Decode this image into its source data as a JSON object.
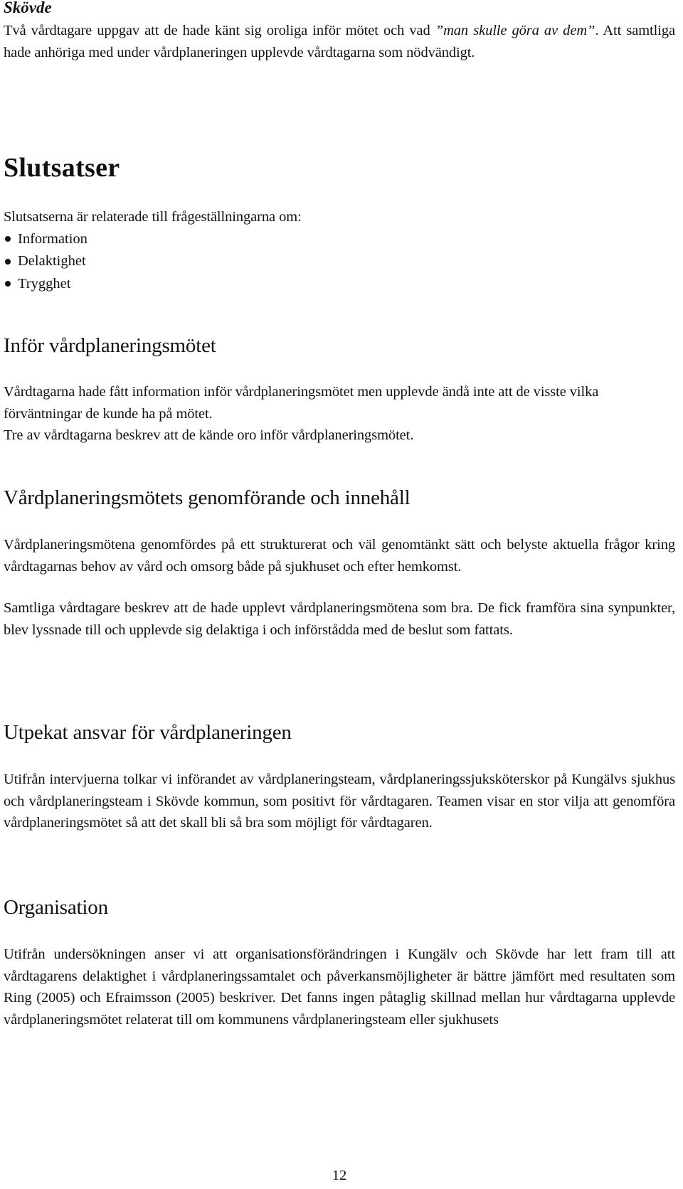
{
  "skovde": {
    "heading": "Skövde",
    "para_start": "Två vårdtagare uppgav att de hade känt sig oroliga inför mötet och vad ",
    "para_quote": "”man skulle göra av dem”",
    "para_end": ". Att samtliga hade anhöriga med under vårdplaneringen upplevde vårdtagarna som nödvändigt."
  },
  "slutsatser": {
    "title": "Slutsatser",
    "intro": "Slutsatserna är relaterade till frågeställningarna om:",
    "items": [
      "Information",
      "Delaktighet",
      "Trygghet"
    ]
  },
  "sections": [
    {
      "title": "Inför vårdplaneringsmötet",
      "paragraphs": [
        "Vårdtagarna hade fått information inför vårdplaneringsmötet men upplevde ändå inte att de visste vilka förväntningar de kunde ha på mötet.",
        "Tre av vårdtagarna beskrev att de kände oro inför vårdplaneringsmötet."
      ]
    },
    {
      "title": "Vårdplaneringsmötets genomförande och innehåll",
      "paragraphs": [
        "Vårdplaneringsmötena genomfördes på ett strukturerat och väl genomtänkt sätt och belyste aktuella frågor kring vårdtagarnas behov av vård och omsorg både på sjukhuset och efter hemkomst.",
        "Samtliga vårdtagare beskrev att de hade upplevt vårdplaneringsmötena som bra. De fick framföra sina synpunkter, blev lyssnade till och upplevde sig delaktiga i och införstådda med de beslut som fattats."
      ]
    },
    {
      "title": "Utpekat ansvar för vårdplaneringen",
      "paragraphs": [
        "Utifrån intervjuerna tolkar vi införandet av vårdplaneringsteam, vårdplaneringssjuksköterskor på Kungälvs sjukhus och vårdplaneringsteam i Skövde kommun, som positivt för vårdtagaren. Teamen visar en stor vilja att genomföra vårdplaneringsmötet så att det skall bli så bra som möjligt för vårdtagaren."
      ]
    },
    {
      "title": "Organisation",
      "paragraphs": [
        "Utifrån undersökningen anser vi att organisationsförändringen i Kungälv och Skövde har lett fram till att vårdtagarens delaktighet i vårdplaneringssamtalet och påverkansmöjligheter är bättre jämfört med resultaten som Ring (2005) och Efraimsson (2005) beskriver. Det fanns ingen påtaglig skillnad mellan hur vårdtagarna upplevde vårdplaneringsmötet relaterat till om kommunens vårdplaneringsteam eller sjukhusets"
      ]
    }
  ],
  "footer": {
    "page_number": "12"
  }
}
